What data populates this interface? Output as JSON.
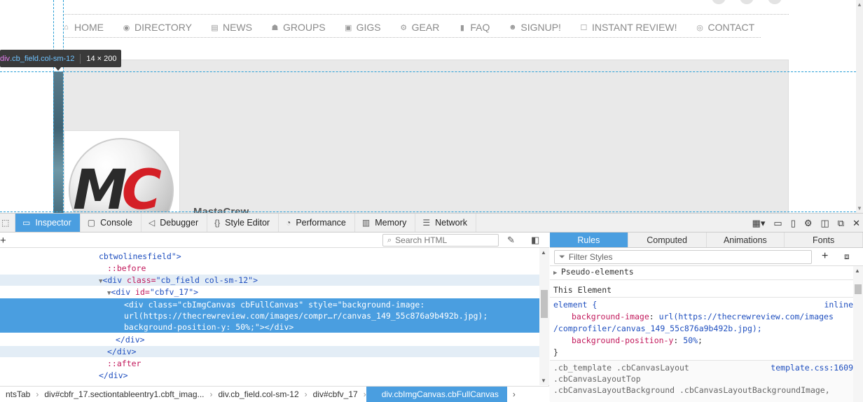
{
  "nav": [
    {
      "icon": "home-icon",
      "glyph": "⌂",
      "label": "HOME"
    },
    {
      "icon": "directory-icon",
      "glyph": "◉",
      "label": "DIRECTORY"
    },
    {
      "icon": "news-icon",
      "glyph": "▤",
      "label": "NEWS"
    },
    {
      "icon": "groups-icon",
      "glyph": "☗",
      "label": "GROUPS"
    },
    {
      "icon": "gigs-icon",
      "glyph": "▣",
      "label": "GIGS"
    },
    {
      "icon": "gear-icon",
      "glyph": "⚙",
      "label": "GEAR"
    },
    {
      "icon": "faq-icon",
      "glyph": "▮",
      "label": "FAQ"
    },
    {
      "icon": "signup-icon",
      "glyph": "☻",
      "label": "SIGNUP!"
    },
    {
      "icon": "instant-review-icon",
      "glyph": "☐",
      "label": "INSTANT REVIEW!"
    },
    {
      "icon": "contact-icon",
      "glyph": "◎",
      "label": "CONTACT"
    }
  ],
  "tooltip": {
    "tag": "div",
    "cls": ".cb_field.col-sm-12",
    "dims": "14 × 200"
  },
  "profile": {
    "name": "MastaCrew",
    "logo_m": "M",
    "logo_c": "C"
  },
  "devtools": {
    "tabs": [
      {
        "icon": "inspector-icon",
        "glyph": "▭",
        "label": "Inspector",
        "active": true
      },
      {
        "icon": "console-icon",
        "glyph": "▢",
        "label": "Console"
      },
      {
        "icon": "debugger-icon",
        "glyph": "◁",
        "label": "Debugger"
      },
      {
        "icon": "style-editor-icon",
        "glyph": "{}",
        "label": "Style Editor"
      },
      {
        "icon": "performance-icon",
        "glyph": "◔",
        "label": "Performance"
      },
      {
        "icon": "memory-icon",
        "glyph": "▥",
        "label": "Memory"
      },
      {
        "icon": "network-icon",
        "glyph": "☰",
        "label": "Network"
      }
    ],
    "search_placeholder": "Search HTML",
    "markup": {
      "line0": "cbtwolinesfield\">",
      "line1": "::before",
      "line2_tag": "<div ",
      "line2_attr": "class=",
      "line2_val": "\"cb_field col-sm-12\"",
      "line2_end": ">",
      "line3_tag": "<div ",
      "line3_attr": "id=",
      "line3_val": "\"cbfv_17\"",
      "line3_end": ">",
      "sel1": "<div class=\"cbImgCanvas cbFullCanvas\" style=\"background-image:",
      "sel2": "url(https://thecrewreview.com/images/compr…r/canvas_149_55c876a9b492b.jpg);",
      "sel3": "background-position-y: 50%;\"></div>",
      "line7": "</div>",
      "line8": "</div>",
      "line9": "::after",
      "line10": "</div>"
    },
    "breadcrumbs": [
      "ntsTab",
      "div#cbfr_17.sectiontableentry1.cbft_imag...",
      "div.cb_field.col-sm-12",
      "div#cbfv_17",
      "div.cbImgCanvas.cbFullCanvas"
    ],
    "side_tabs": [
      "Rules",
      "Computed",
      "Animations",
      "Fonts"
    ],
    "filter_placeholder": "Filter Styles",
    "rules": {
      "pseudo": "Pseudo-elements",
      "this_element": "This Element",
      "element_sel": "element {",
      "element_src": "inline",
      "prop1": "background-image",
      "val1a": "url(https://thecrewreview.com/images",
      "val1b": "/comprofiler/canvas_149_55c876a9b492b.jpg);",
      "prop2": "background-position-y",
      "val2": "50%",
      "close": "}",
      "sel2_line1": ".cb_template .cbCanvasLayout",
      "sel2_src": "template.css:1609",
      "sel2_line2": ".cbCanvasLayoutTop",
      "sel2_line3": ".cbCanvasLayoutBackground .cbCanvasLayoutBackgroundImage,"
    }
  }
}
